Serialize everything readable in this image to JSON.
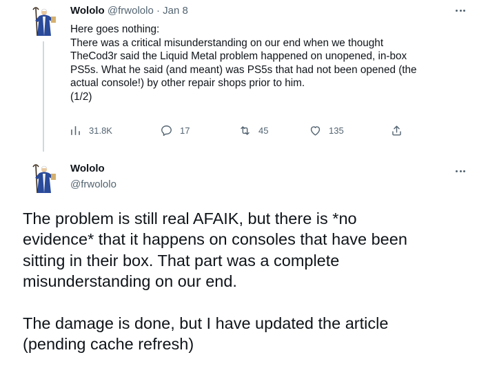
{
  "tweet1": {
    "author_name": "Wololo",
    "handle": "@frwololo",
    "separator": "·",
    "date": "Jan 8",
    "body_lines": [
      "Here goes nothing:",
      "There was a critical misunderstanding on our end when we thought",
      "TheCod3r said the Liquid Metal problem happened on unopened, in-box",
      "PS5s. What he said (and meant) was PS5s that had not been opened (the",
      "actual console!) by other repair shops prior to him.",
      "(1/2)"
    ],
    "actions": {
      "views_icon": "analytics-bars-icon",
      "views": "31.8K",
      "replies_icon": "reply-bubble-icon",
      "replies": "17",
      "retweets_icon": "retweet-icon",
      "retweets": "45",
      "likes_icon": "heart-icon",
      "likes": "135",
      "share_icon": "share-upload-icon"
    }
  },
  "tweet2": {
    "author_name": "Wololo",
    "handle": "@frwololo",
    "paragraph1_lines": [
      "The problem is still real AFAIK, but there is *no",
      "evidence* that it happens on consoles that have been",
      "sitting in their box. That part was a complete",
      "misunderstanding on our end."
    ],
    "paragraph2_lines": [
      "The damage is done, but I have updated the article",
      "(pending cache refresh)"
    ]
  },
  "colors": {
    "text_primary": "#0f1419",
    "text_secondary": "#536471",
    "thread_line": "#cfd9de",
    "avatar_robe": "#2a4a9a"
  }
}
